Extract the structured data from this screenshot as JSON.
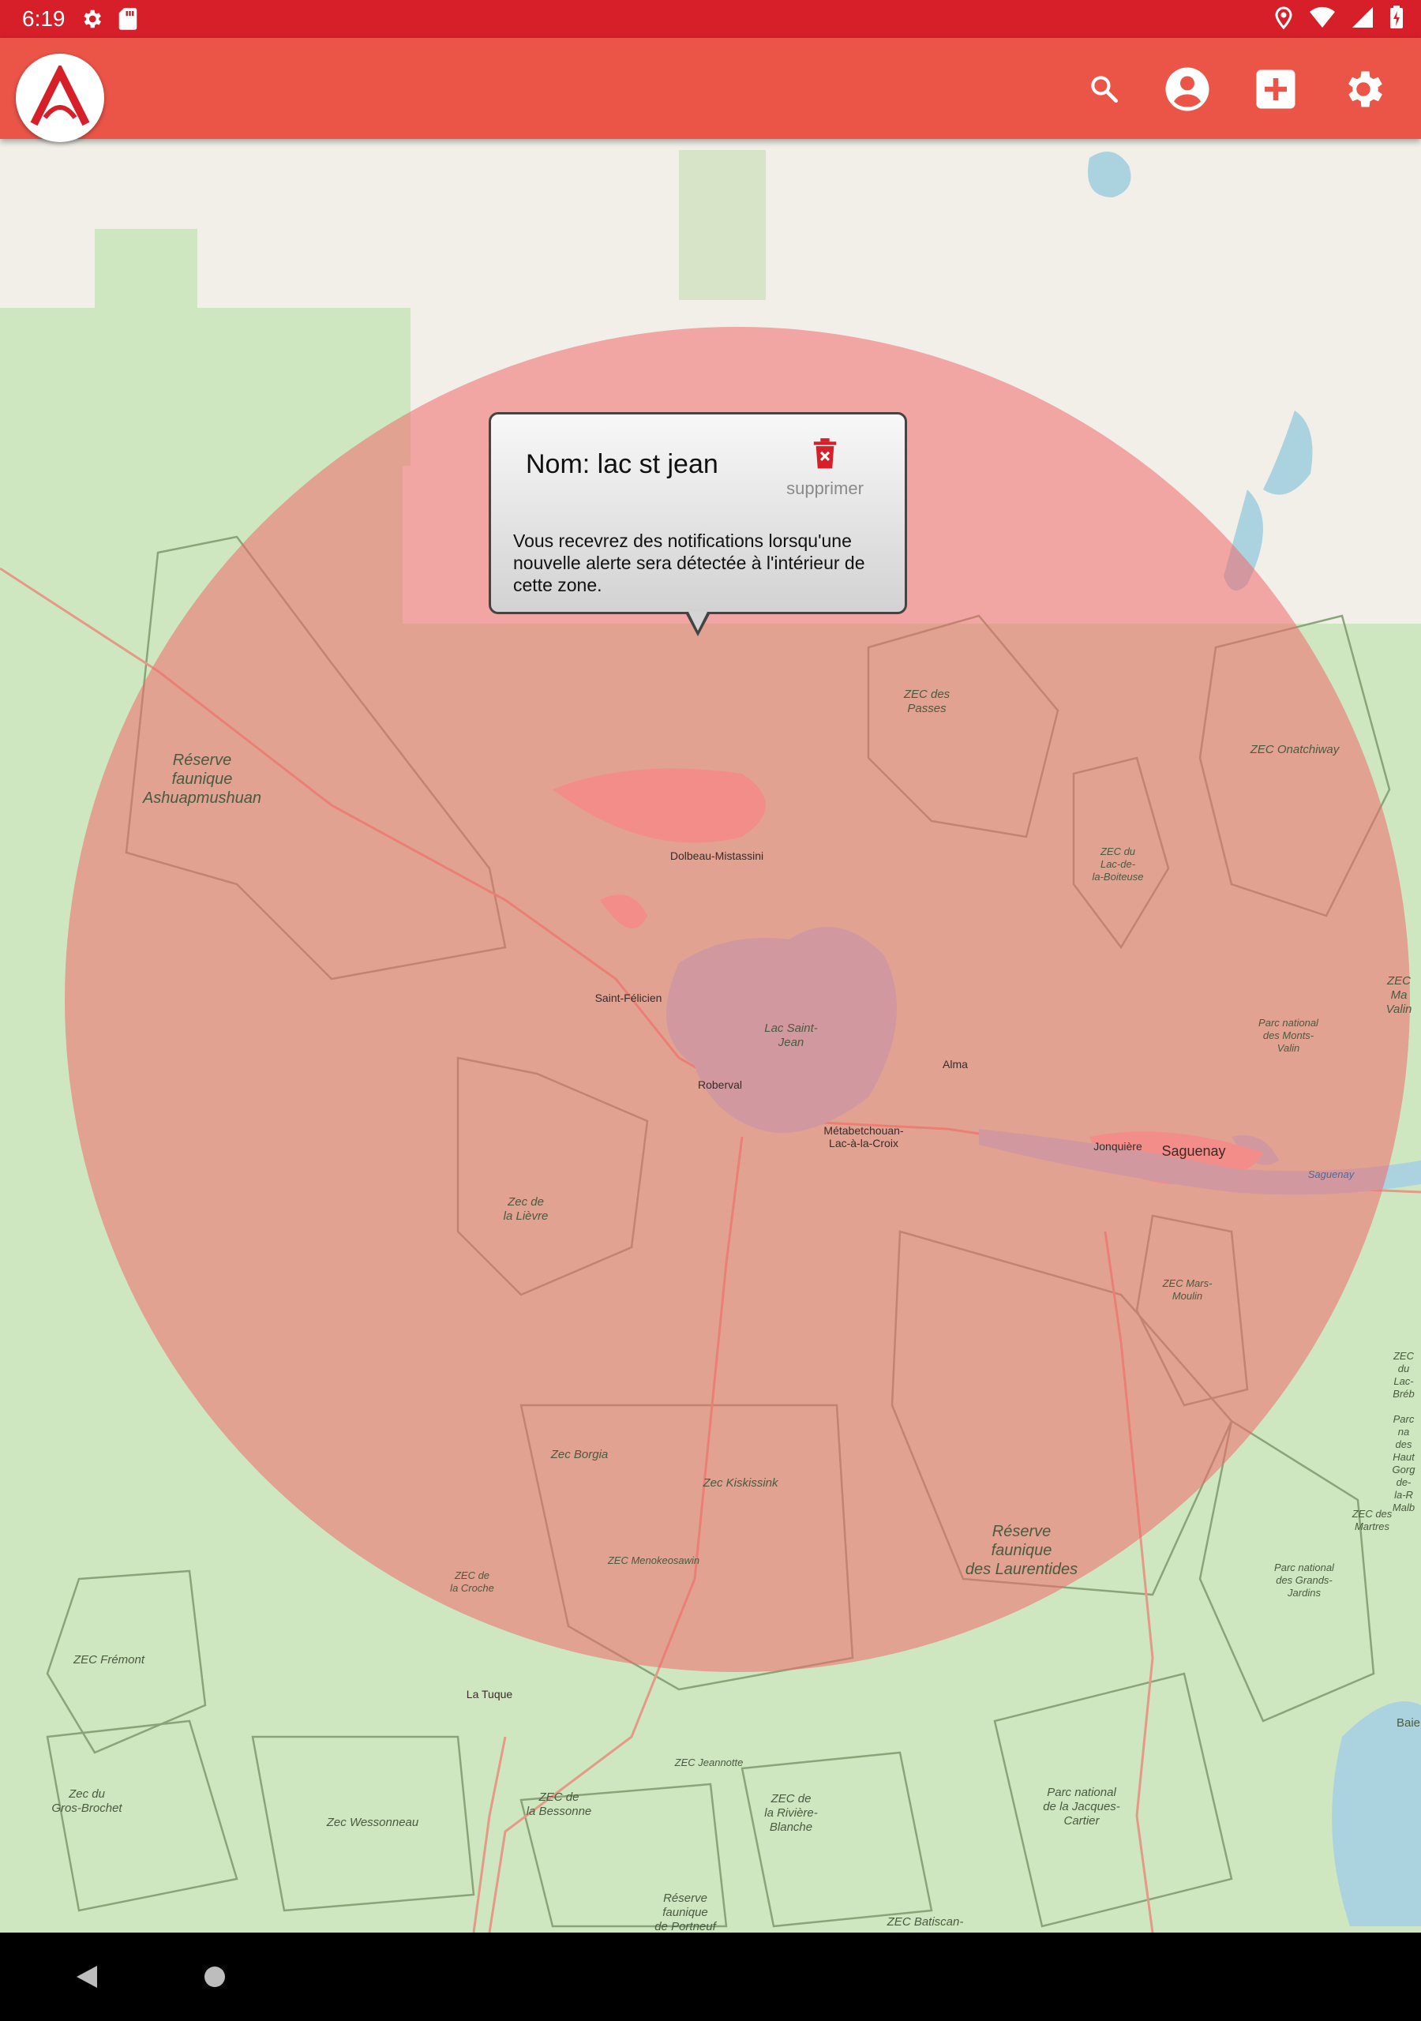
{
  "status_bar": {
    "time": "6:19",
    "icons": [
      "gear-icon",
      "sd-card-icon",
      "location-icon",
      "wifi-icon",
      "signal-icon",
      "battery-icon"
    ]
  },
  "app_bar": {
    "logo": "app-logo",
    "actions": [
      "search-icon",
      "account-icon",
      "add-box-icon",
      "settings-icon"
    ],
    "color": "#ea5548"
  },
  "popup": {
    "title": "Nom: lac st jean",
    "delete_label": "supprimer",
    "message": "Vous recevrez des notifications lorsqu'une nouvelle alerte sera détectée à l'intérieur de cette zone."
  },
  "zone": {
    "color": "#f06a6a"
  },
  "map_labels": {
    "reserve_ashuapmushuan": "Réserve\nfaunique\nAshuapmushuan",
    "zec_des_passes": "ZEC des\nPasses",
    "zec_onatchiway": "ZEC Onatchiway",
    "zec_lac_boiteuse": "ZEC du\nLac-de-\nla-Boiteuse",
    "lac_saint_jean": "Lac Saint-\nJean",
    "parc_monts_valin": "Parc national\ndes Monts-\nValin",
    "zec_ma_valin": "ZEC Ma\nValin",
    "zec_de_la_lievre": "Zec de\nla Lièvre",
    "zec_mars_moulin": "ZEC Mars-\nMoulin",
    "zec_borgia": "Zec Borgia",
    "zec_kiskissink": "Zec Kiskissink",
    "zec_menokeosawin": "ZEC Menokeosawin",
    "zec_de_la_croche": "ZEC de\nla Croche",
    "reserve_laurentides": "Réserve\nfaunique\ndes Laurentides",
    "zec_du_lac_brebis": "ZEC du\nLac-Bréb",
    "parc_hautes_gorges": "Parc na\ndes Haut\nGorg\nde-la-R\nMalb",
    "zec_des_martres": "ZEC des\nMartres",
    "parc_grands_jardins": "Parc national\ndes Grands-\nJardins",
    "zec_fremont": "ZEC Frémont",
    "zec_gros_brochet": "Zec du\nGros-Brochet",
    "zec_wessonneau": "Zec Wessonneau",
    "zec_de_la_bessonne": "ZEC de\nla Bessonne",
    "zec_jeannotte": "ZEC Jeannotte",
    "zec_riviere_blanche": "ZEC de\nla Rivière-\nBlanche",
    "parc_jacques_cartier": "Parc national\nde la Jacques-\nCartier",
    "reserve_portneuf": "Réserve\nfaunique\nde Portneuf",
    "zec_batiscan": "ZEC Batiscan-",
    "baie": "Baie"
  },
  "map_cities": {
    "dolbeau": "Dolbeau-Mistassini",
    "saint_felicien": "Saint-Félicien",
    "roberval": "Roberval",
    "alma": "Alma",
    "metabetchouan": "Métabetchouan-\nLac-à-la-Croix",
    "jonquiere": "Jonquière",
    "saguenay": "Saguenay",
    "saguenay_river": "Saguenay",
    "la_tuque": "La Tuque"
  },
  "nav_bar": {
    "buttons": [
      "back-icon",
      "home-icon"
    ]
  }
}
